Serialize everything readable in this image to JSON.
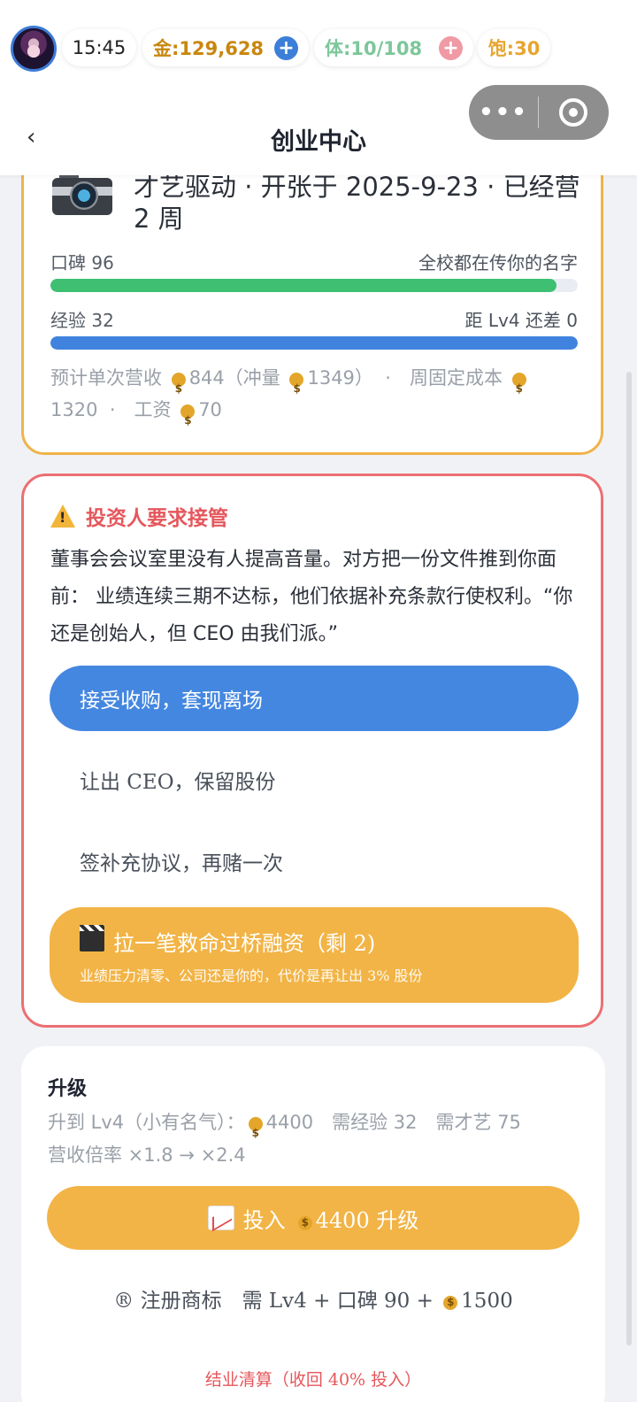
{
  "status": {
    "time": "15:45",
    "gold": "金:129,628",
    "stamina": "体:10/108",
    "full": "饱:30"
  },
  "nav": {
    "back": "‹",
    "title": "创业中心",
    "more": "•••"
  },
  "business": {
    "subtitle": "才艺驱动 · 开张于 2025-9-23 · 已经营 2 周",
    "reputation_label": "口碑 96",
    "reputation_note": "全校都在传你的名字",
    "reputation_progress": 0.96,
    "exp_label": "经验 32",
    "exp_note": "距 Lv4 还差 0",
    "exp_progress": 1.0,
    "info_revenue_prefix": "预计单次营收",
    "info_revenue": "844（冲量",
    "info_revenue_rush": "1349）",
    "info_cost_prefix": "·　周固定成本",
    "info_cost": "1320",
    "info_wage_prefix": "·　工资",
    "info_wage": "70",
    "colors": {
      "reputation": "#3ebf72",
      "exp": "#3f83df",
      "border": "#efb34a"
    }
  },
  "event": {
    "title": "投资人要求接管",
    "text": "董事会会议室里没有人提高音量。对方把一份文件推到你面前： 业绩连续三期不达标，他们依据补充条款行使权利。“你还是创始人，但 CEO 由我们派。”",
    "option_accept": "接受收购，套现离场",
    "option_cede": "让出 CEO，保留股份",
    "option_sign": "签补充协议，再赌一次",
    "option_rescue": "拉一笔救命过桥融资（剩 2)",
    "option_rescue_sub": "业绩压力清零、公司还是你的，代价是再让出 3% 股份",
    "colors": {
      "border": "#ec6f73",
      "primary": "#4487e0",
      "rescue": "#f2b446"
    }
  },
  "upgrade": {
    "title": "升级",
    "info_prefix": "升到 Lv4（小有名气）：",
    "info_cost": "4400",
    "info_req": "需经验 32　需才艺 75",
    "info_rate": "营收倍率 ×1.8 → ×2.4",
    "button_prefix": "投入",
    "button_cost": "4400 升级",
    "trademark": "® 注册商标　需 Lv4 + 口碑 90 +",
    "trademark_cost": "1500",
    "liquidate": "结业清算（收回 40% 投入）"
  }
}
